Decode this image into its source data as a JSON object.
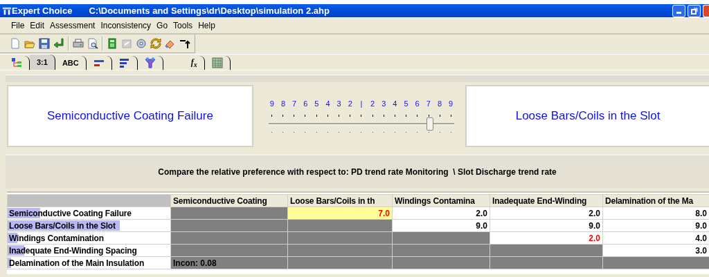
{
  "window": {
    "app_title": "Expert Choice",
    "file_path": "C:\\Documents and Settings\\dr\\Desktop\\simulation 2.ahp"
  },
  "menu": [
    "File",
    "Edit",
    "Assessment",
    "Inconsistency",
    "Go",
    "Tools",
    "Help"
  ],
  "toolbar": [
    {
      "kind": "new"
    },
    {
      "kind": "open"
    },
    {
      "kind": "save"
    },
    {
      "kind": "enter"
    },
    {
      "kind": "sep"
    },
    {
      "kind": "print"
    },
    {
      "kind": "preview"
    },
    {
      "kind": "sep"
    },
    {
      "kind": "calculator"
    },
    {
      "kind": "disabled"
    },
    {
      "kind": "disks"
    },
    {
      "kind": "refresh"
    },
    {
      "kind": "eraser"
    },
    {
      "kind": "arrow"
    }
  ],
  "tabs": [
    {
      "kind": "tree",
      "selected": false
    },
    {
      "kind": "text",
      "label": "3:1",
      "selected": true
    },
    {
      "kind": "text",
      "label": "ABC",
      "selected": false
    },
    {
      "kind": "hbar",
      "selected": false
    },
    {
      "kind": "bars",
      "selected": false
    },
    {
      "kind": "funnel",
      "selected": false
    },
    {
      "kind": "text",
      "label": "f$_{x}$",
      "selected": false
    },
    {
      "kind": "grid",
      "selected": false
    }
  ],
  "compare": {
    "left": "Semiconductive Coating Failure",
    "right": "Loose Bars/Coils in the Slot",
    "scale": [
      "9",
      "8",
      "7",
      "6",
      "5",
      "4",
      "3",
      "2",
      "|",
      "2",
      "3",
      "4",
      "5",
      "6",
      "7",
      "8",
      "9"
    ],
    "level": 0.875
  },
  "question": "Compare the relative preference with respect to: PD trend rate Monitoring  \\ Slot Discharge trend rate",
  "matrix": {
    "columns": [
      "Semiconductive Coating",
      "Loose Bars/Coils in th",
      "Windings Contamina",
      "Inadequate End-Winding",
      "Delamination of the Ma"
    ],
    "rows": [
      {
        "label": "Semiconductive Coating Failure",
        "level": 0.2,
        "cells": [
          {
            "kind": "grey"
          },
          {
            "kind": "selected",
            "text": "7.0",
            "inconsistent": true
          },
          {
            "kind": "white",
            "text": "2.0",
            "inconsistent": false
          },
          {
            "kind": "white",
            "text": "2.0",
            "inconsistent": false
          },
          {
            "kind": "white",
            "text": "8.0",
            "inconsistent": false
          }
        ]
      },
      {
        "label": "Loose Bars/Coils in the Slot",
        "level": 0.69,
        "cells": [
          {
            "kind": "grey"
          },
          {
            "kind": "grey"
          },
          {
            "kind": "white",
            "text": "9.0",
            "inconsistent": false
          },
          {
            "kind": "white",
            "text": "9.0",
            "inconsistent": false
          },
          {
            "kind": "white",
            "text": "9.0",
            "inconsistent": false
          }
        ]
      },
      {
        "label": "Windings Contamination",
        "level": 0.06,
        "cells": [
          {
            "kind": "grey"
          },
          {
            "kind": "grey"
          },
          {
            "kind": "grey"
          },
          {
            "kind": "white",
            "text": "2.0",
            "inconsistent": true
          },
          {
            "kind": "white",
            "text": "4.0",
            "inconsistent": false
          }
        ]
      },
      {
        "label": "Inadequate End-Winding Spacing",
        "level": 0.1,
        "cells": [
          {
            "kind": "grey"
          },
          {
            "kind": "grey"
          },
          {
            "kind": "grey"
          },
          {
            "kind": "grey"
          },
          {
            "kind": "white",
            "text": "3.0",
            "inconsistent": false
          }
        ]
      },
      {
        "label": "Delamination of the Main Insulation",
        "level": 0.02,
        "cells": [
          {
            "kind": "grey",
            "text": "Incon: 0.08"
          },
          {
            "kind": "grey"
          },
          {
            "kind": "grey"
          },
          {
            "kind": "grey"
          },
          {
            "kind": "grey"
          }
        ]
      }
    ]
  }
}
